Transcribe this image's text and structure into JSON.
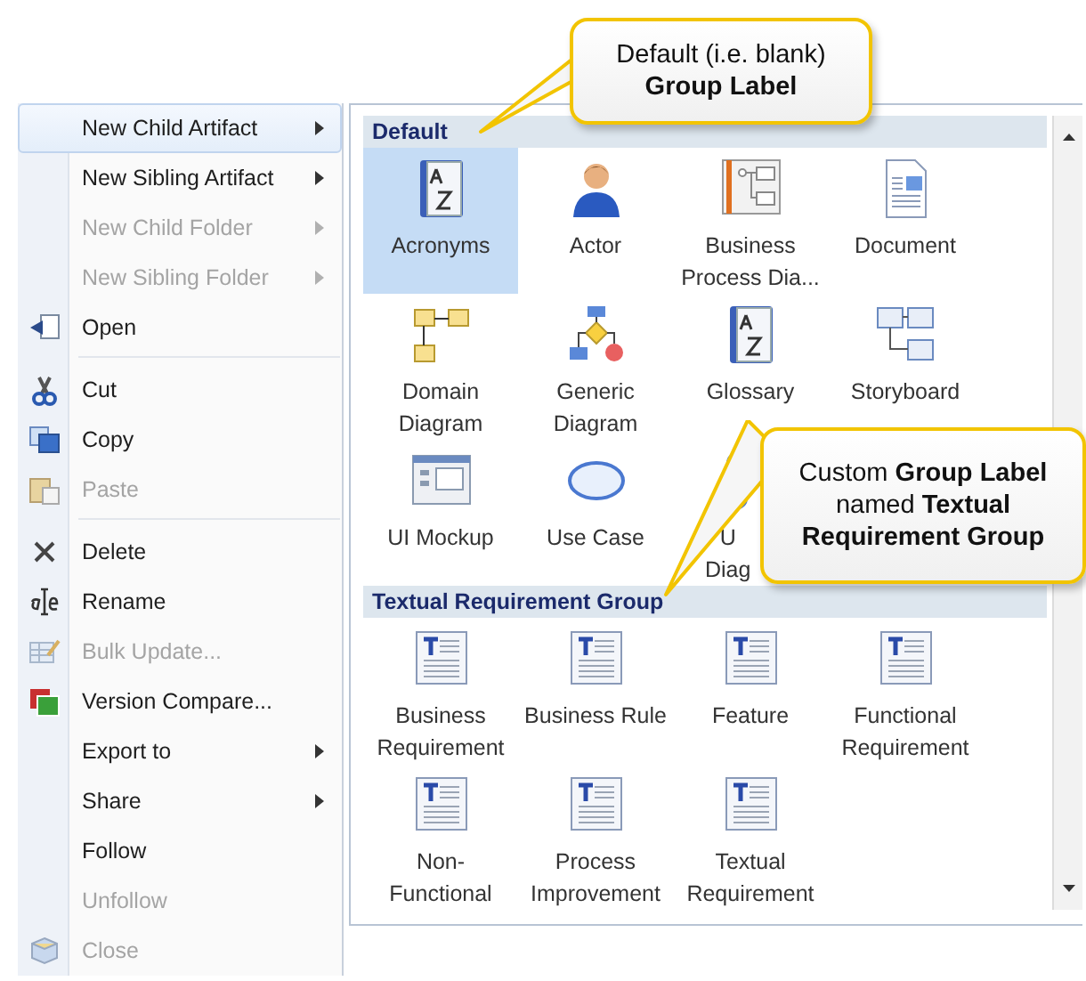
{
  "menu": [
    {
      "label": "New Child Artifact",
      "disabled": false,
      "selected": true,
      "submenu": true,
      "separator_after": false
    },
    {
      "label": "New Sibling Artifact",
      "disabled": false,
      "selected": false,
      "submenu": true,
      "separator_after": false
    },
    {
      "label": "New Child Folder",
      "disabled": true,
      "selected": false,
      "submenu": true,
      "separator_after": false
    },
    {
      "label": "New Sibling Folder",
      "disabled": true,
      "selected": false,
      "submenu": true,
      "separator_after": false
    },
    {
      "label": "Open",
      "disabled": false,
      "selected": false,
      "submenu": false,
      "separator_after": true
    },
    {
      "label": "Cut",
      "disabled": false,
      "selected": false,
      "submenu": false,
      "separator_after": false
    },
    {
      "label": "Copy",
      "disabled": false,
      "selected": false,
      "submenu": false,
      "separator_after": false
    },
    {
      "label": "Paste",
      "disabled": true,
      "selected": false,
      "submenu": false,
      "separator_after": true
    },
    {
      "label": "Delete",
      "disabled": false,
      "selected": false,
      "submenu": false,
      "separator_after": false
    },
    {
      "label": "Rename",
      "disabled": false,
      "selected": false,
      "submenu": false,
      "separator_after": false
    },
    {
      "label": "Bulk Update...",
      "disabled": true,
      "selected": false,
      "submenu": false,
      "separator_after": false
    },
    {
      "label": "Version Compare...",
      "disabled": false,
      "selected": false,
      "submenu": false,
      "separator_after": false
    },
    {
      "label": "Export to",
      "disabled": false,
      "selected": false,
      "submenu": true,
      "separator_after": false
    },
    {
      "label": "Share",
      "disabled": false,
      "selected": false,
      "submenu": true,
      "separator_after": false
    },
    {
      "label": "Follow",
      "disabled": false,
      "selected": false,
      "submenu": false,
      "separator_after": false
    },
    {
      "label": "Unfollow",
      "disabled": true,
      "selected": false,
      "submenu": false,
      "separator_after": false
    },
    {
      "label": "Close",
      "disabled": true,
      "selected": false,
      "submenu": false,
      "separator_after": false
    }
  ],
  "groups": [
    {
      "label": "Default",
      "items": [
        {
          "lines": [
            "Acronyms"
          ],
          "selected": true
        },
        {
          "lines": [
            "Actor"
          ],
          "selected": false
        },
        {
          "lines": [
            "Business",
            "Process Dia..."
          ],
          "selected": false
        },
        {
          "lines": [
            "Document"
          ],
          "selected": false
        },
        {
          "lines": [
            "Domain",
            "Diagram"
          ],
          "selected": false
        },
        {
          "lines": [
            "Generic",
            "Diagram"
          ],
          "selected": false
        },
        {
          "lines": [
            "Glossary"
          ],
          "selected": false
        },
        {
          "lines": [
            "Storyboard"
          ],
          "selected": false
        },
        {
          "lines": [
            "UI Mockup"
          ],
          "selected": false
        },
        {
          "lines": [
            "Use Case"
          ],
          "selected": false
        },
        {
          "lines": [
            "U",
            "Diag"
          ],
          "selected": false,
          "covered": true
        }
      ]
    },
    {
      "label": "Textual Requirement Group",
      "items": [
        {
          "lines": [
            "Business",
            "Requirement"
          ],
          "selected": false
        },
        {
          "lines": [
            "Business Rule"
          ],
          "selected": false
        },
        {
          "lines": [
            "Feature"
          ],
          "selected": false
        },
        {
          "lines": [
            "Functional",
            "Requirement"
          ],
          "selected": false
        },
        {
          "lines": [
            "Non-",
            "Functional"
          ],
          "selected": false
        },
        {
          "lines": [
            "Process",
            "Improvement"
          ],
          "selected": false
        },
        {
          "lines": [
            "Textual",
            "Requirement"
          ],
          "selected": false
        }
      ]
    }
  ],
  "callouts": [
    "Default (i.e. blank) **Group Label**",
    "Custom **Group Label** named **Textual Requirement Group**"
  ]
}
